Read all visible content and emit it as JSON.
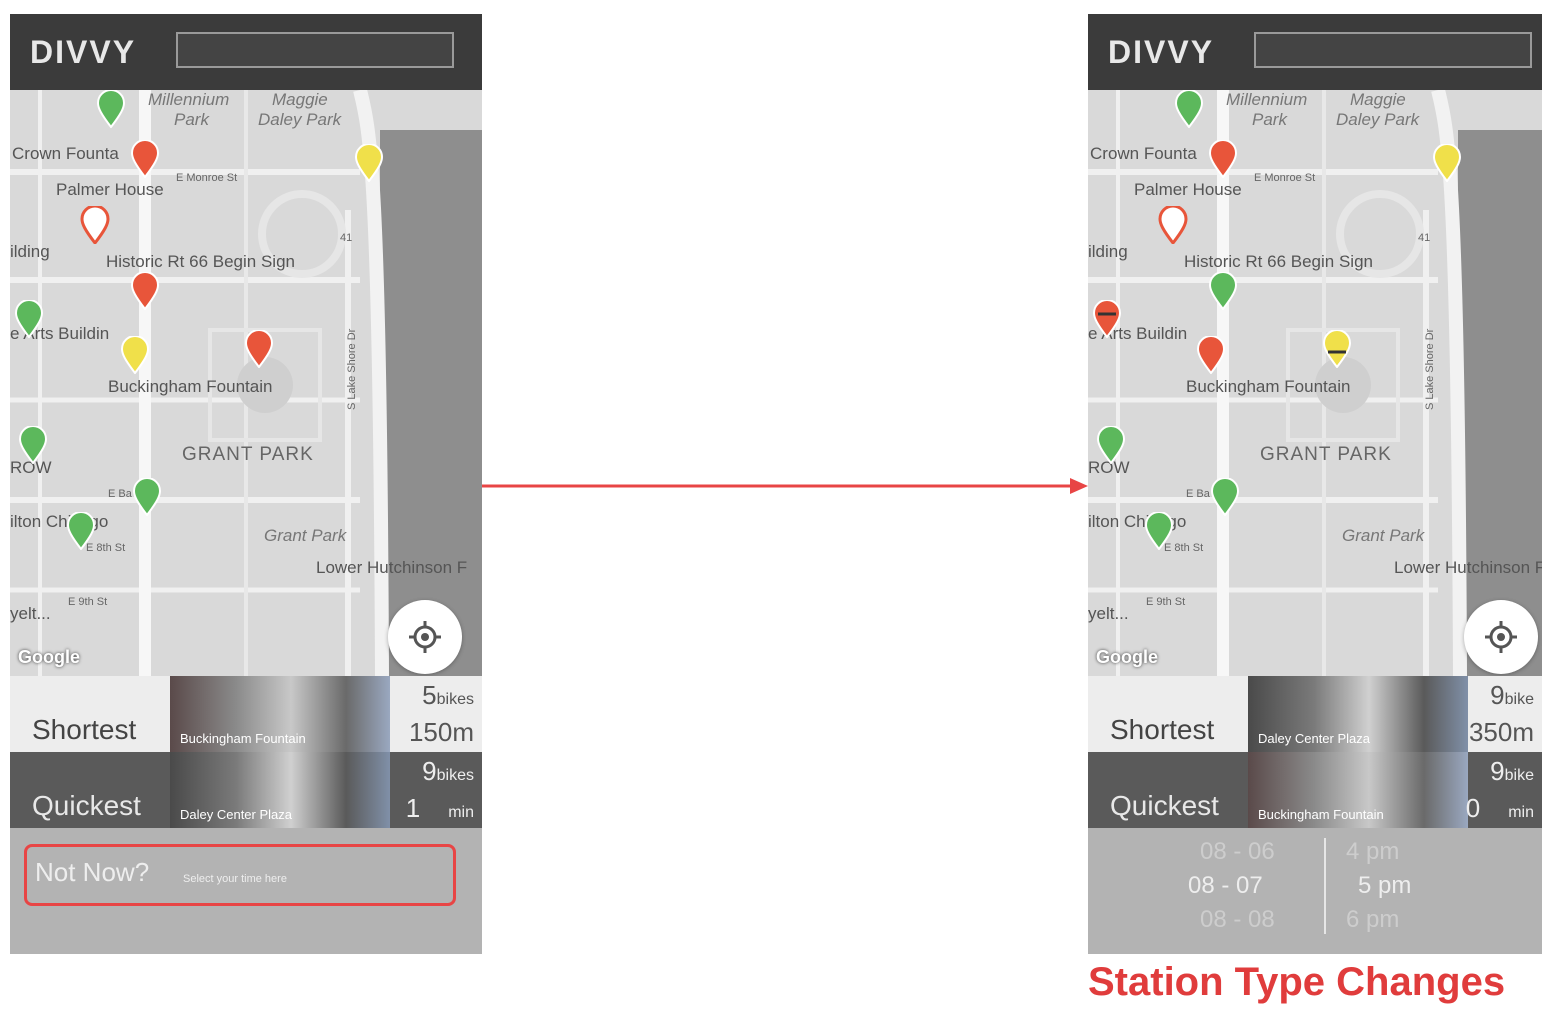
{
  "brand": {
    "logo": "DIVVY"
  },
  "map_labels": [
    {
      "text": "Millennium",
      "style": "italic"
    },
    {
      "text": "Park",
      "style": "italic"
    },
    {
      "text": "Maggie",
      "style": "italic"
    },
    {
      "text": "Daley Park",
      "style": "italic"
    },
    {
      "text": "Crown Founta",
      "style": "normal"
    },
    {
      "text": "E Monroe St",
      "style": "small"
    },
    {
      "text": "Palmer House",
      "style": "normal"
    },
    {
      "text": "ilding",
      "style": "normal"
    },
    {
      "text": "Historic Rt 66 Begin Sign",
      "style": "normal"
    },
    {
      "text": "e Arts Buildin",
      "style": "normal"
    },
    {
      "text": "Buckingham Fountain",
      "style": "normal"
    },
    {
      "text": "GRANT PARK",
      "style": "park"
    },
    {
      "text": "ROW",
      "style": "normal"
    },
    {
      "text": "E Ba",
      "style": "small"
    },
    {
      "text": "ilton Chicago",
      "style": "normal"
    },
    {
      "text": "E 8th St",
      "style": "small"
    },
    {
      "text": "Grant Park",
      "style": "italic"
    },
    {
      "text": "Lower Hutchinson F",
      "style": "normal"
    },
    {
      "text": "E 9th St",
      "style": "small"
    },
    {
      "text": "yelt...",
      "style": "normal"
    },
    {
      "text": "S Lake Shore Dr",
      "style": "small"
    },
    {
      "text": "41",
      "style": "small"
    }
  ],
  "map_attribution": "Google",
  "left_screen": {
    "shortest": {
      "label": "Shortest",
      "station": "Buckingham Fountain",
      "bikes": "5",
      "bikes_unit": "bikes",
      "distance": "150m"
    },
    "quickest": {
      "label": "Quickest",
      "station": "Daley Center Plaza",
      "bikes": "9",
      "bikes_unit": "bikes",
      "time": "1",
      "time_unit": "min"
    },
    "not_now": {
      "title": "Not Now?",
      "subtitle": "Select your time here"
    }
  },
  "right_screen": {
    "shortest": {
      "label": "Shortest",
      "station": "Daley Center Plaza",
      "bikes": "9",
      "bikes_unit": "bike",
      "distance": "350m"
    },
    "quickest": {
      "label": "Quickest",
      "station": "Buckingham Fountain",
      "bikes": "9",
      "bikes_unit": "bike",
      "time": "0",
      "time_unit": "min"
    },
    "time_picker": {
      "dates": [
        "08 - 06",
        "08 - 07",
        "08 - 08"
      ],
      "times": [
        "4 pm",
        "5 pm",
        "6 pm"
      ],
      "selected_date": "08 - 07",
      "selected_time": "5 pm"
    }
  },
  "caption": "Station Type Changes",
  "colors": {
    "pin_red": "#e8553a",
    "pin_green": "#5cb85c",
    "pin_yellow": "#f0e04a",
    "highlight": "#e84545",
    "topbar": "#3b3b3b"
  }
}
